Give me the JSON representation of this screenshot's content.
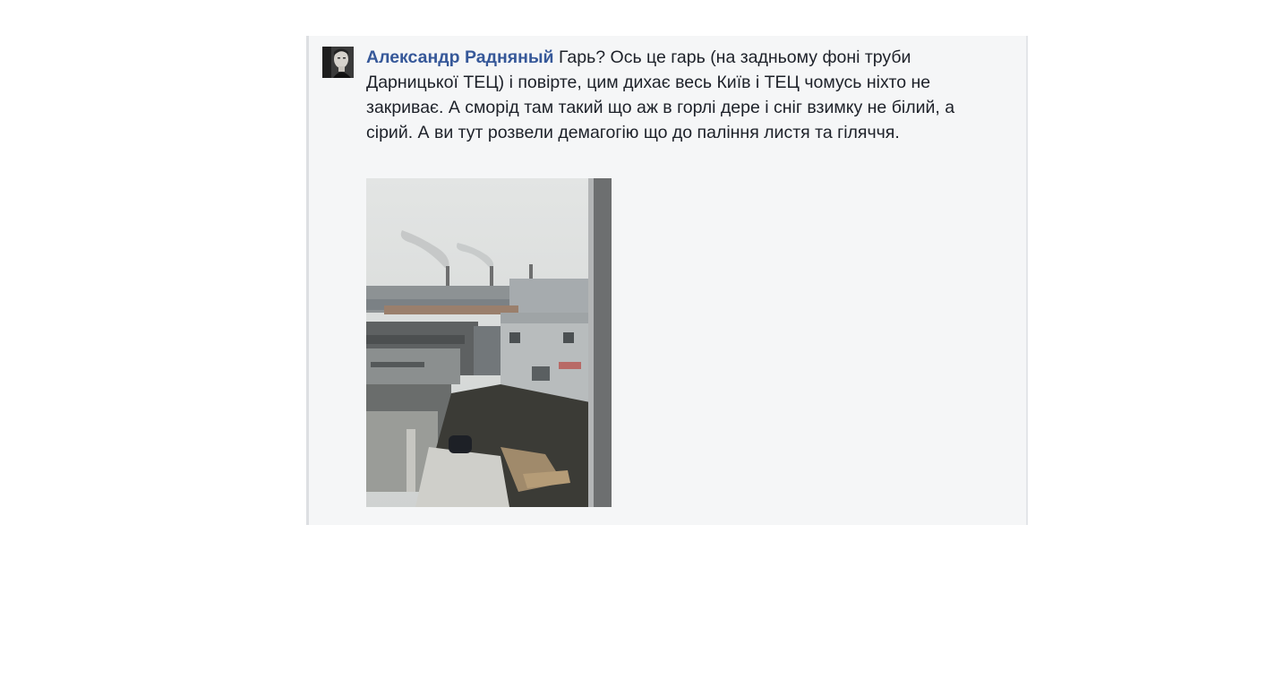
{
  "comment": {
    "author_name": "Александр Радняный",
    "text": "Гарь? Ось це гарь (на задньому фоні труби Дарницької ТЕЦ) і повірте, цим дихає весь Київ і ТЕЦ чомусь ніхто не закриває. А сморід там такий що аж в горлі дере і сніг взимку не білий, а сірий. А ви тут розвели демагогію що до паління листя та гіляччя."
  },
  "colors": {
    "author_link": "#365899",
    "card_background": "#f5f6f7",
    "text": "#1d2129"
  }
}
